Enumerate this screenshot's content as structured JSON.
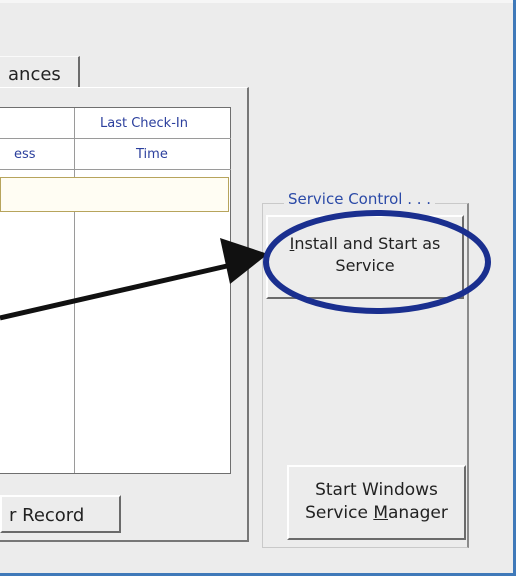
{
  "tabs": {
    "active_label": "ances"
  },
  "grid": {
    "header_row1": {
      "col2": "Last Check-In"
    },
    "header_row2": {
      "col1": "ess",
      "col2": "Time"
    }
  },
  "buttons": {
    "record": "r Record",
    "install_line1_prefix": "",
    "install_line1_u": "I",
    "install_line1_rest": "nstall and Start as",
    "install_line2": "Service",
    "svcmgr_line1": "Start Windows",
    "svcmgr_line2_a": "Service ",
    "svcmgr_line2_u": "M",
    "svcmgr_line2_b": "anager"
  },
  "service_control": {
    "legend": "Service Control . . ."
  },
  "colors": {
    "window_border": "#3f79b9",
    "annotation_ellipse": "#1a2f8f",
    "annotation_arrow": "#111111"
  }
}
